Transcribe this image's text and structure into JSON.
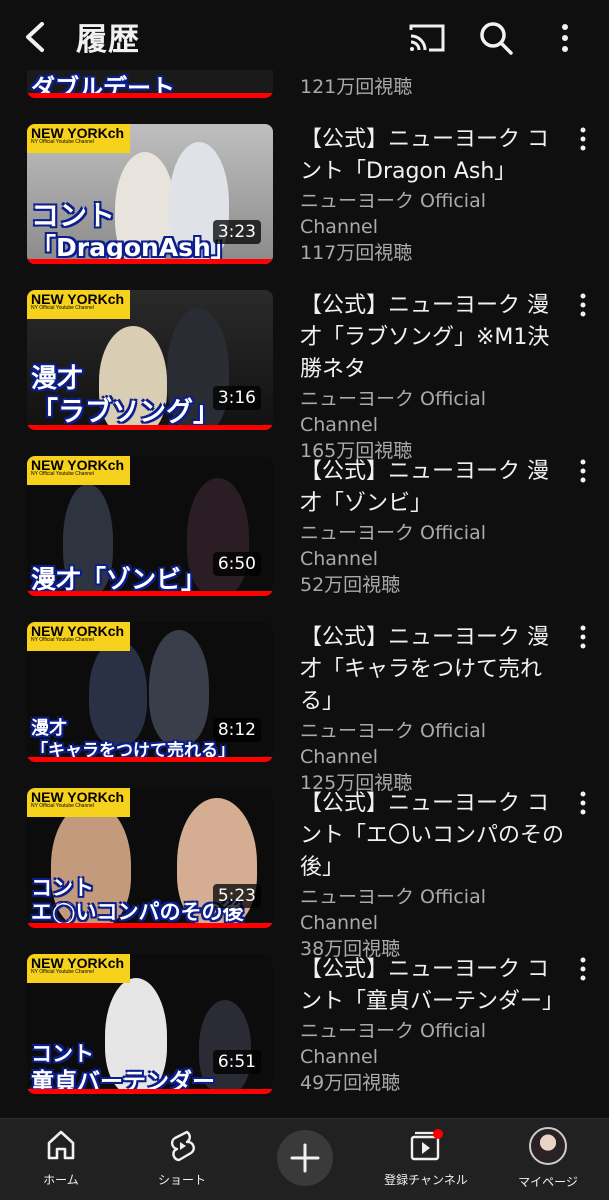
{
  "header": {
    "title": "履歴"
  },
  "partial": {
    "caption": "ダブルデート",
    "views": "121万回視聴"
  },
  "videos": [
    {
      "title": "【公式】ニューヨーク コント「Dragon Ash」",
      "channel": "ニューヨーク Official Channel",
      "views": "117万回視聴",
      "duration": "3:23",
      "brand": "NEW YORKch",
      "caption_line1": "コント",
      "caption_line2": "「DragonAsh」",
      "progress": 1.0
    },
    {
      "title": "【公式】ニューヨーク 漫才「ラブソング」※M1決勝ネタ",
      "channel": "ニューヨーク Official Channel",
      "views": "165万回視聴",
      "duration": "3:16",
      "brand": "NEW YORKch",
      "caption_line1": "漫才",
      "caption_line2": "「ラブソング」",
      "progress": 1.0
    },
    {
      "title": "【公式】ニューヨーク 漫才「ゾンビ」",
      "channel": "ニューヨーク Official Channel",
      "views": "52万回視聴",
      "duration": "6:50",
      "brand": "NEW YORKch",
      "caption_line1": "",
      "caption_line2": "漫才「ゾンビ」",
      "progress": 1.0
    },
    {
      "title": "【公式】ニューヨーク 漫才「キャラをつけて売れる」",
      "channel": "ニューヨーク Official Channel",
      "views": "125万回視聴",
      "duration": "8:12",
      "brand": "NEW YORKch",
      "caption_line1": "漫才",
      "caption_line2": "「キャラをつけて売れる」",
      "progress": 1.0
    },
    {
      "title": "【公式】ニューヨーク コント「エ〇いコンパのその後」",
      "channel": "ニューヨーク Official Channel",
      "views": "38万回視聴",
      "duration": "5:23",
      "brand": "NEW YORKch",
      "caption_line1": "コント",
      "caption_line2": "エ◯いコンパのその後",
      "progress": 1.0
    },
    {
      "title": "【公式】ニューヨーク コント「童貞バーテンダー」",
      "channel": "ニューヨーク Official Channel",
      "views": "49万回視聴",
      "duration": "6:51",
      "brand": "NEW YORKch",
      "caption_line1": "コント",
      "caption_line2": "童貞バーテンダー",
      "progress": 1.0
    }
  ],
  "nav": {
    "home": "ホーム",
    "shorts": "ショート",
    "subscriptions": "登録チャンネル",
    "mypage": "マイページ"
  },
  "colors": {
    "accent": "#ff0000",
    "brand_yellow": "#f7d21d",
    "background": "#0f0f0f"
  },
  "icons": [
    "back-arrow-icon",
    "cast-icon",
    "search-icon",
    "more-vert-icon",
    "home-icon",
    "shorts-icon",
    "plus-icon",
    "subscriptions-icon"
  ]
}
